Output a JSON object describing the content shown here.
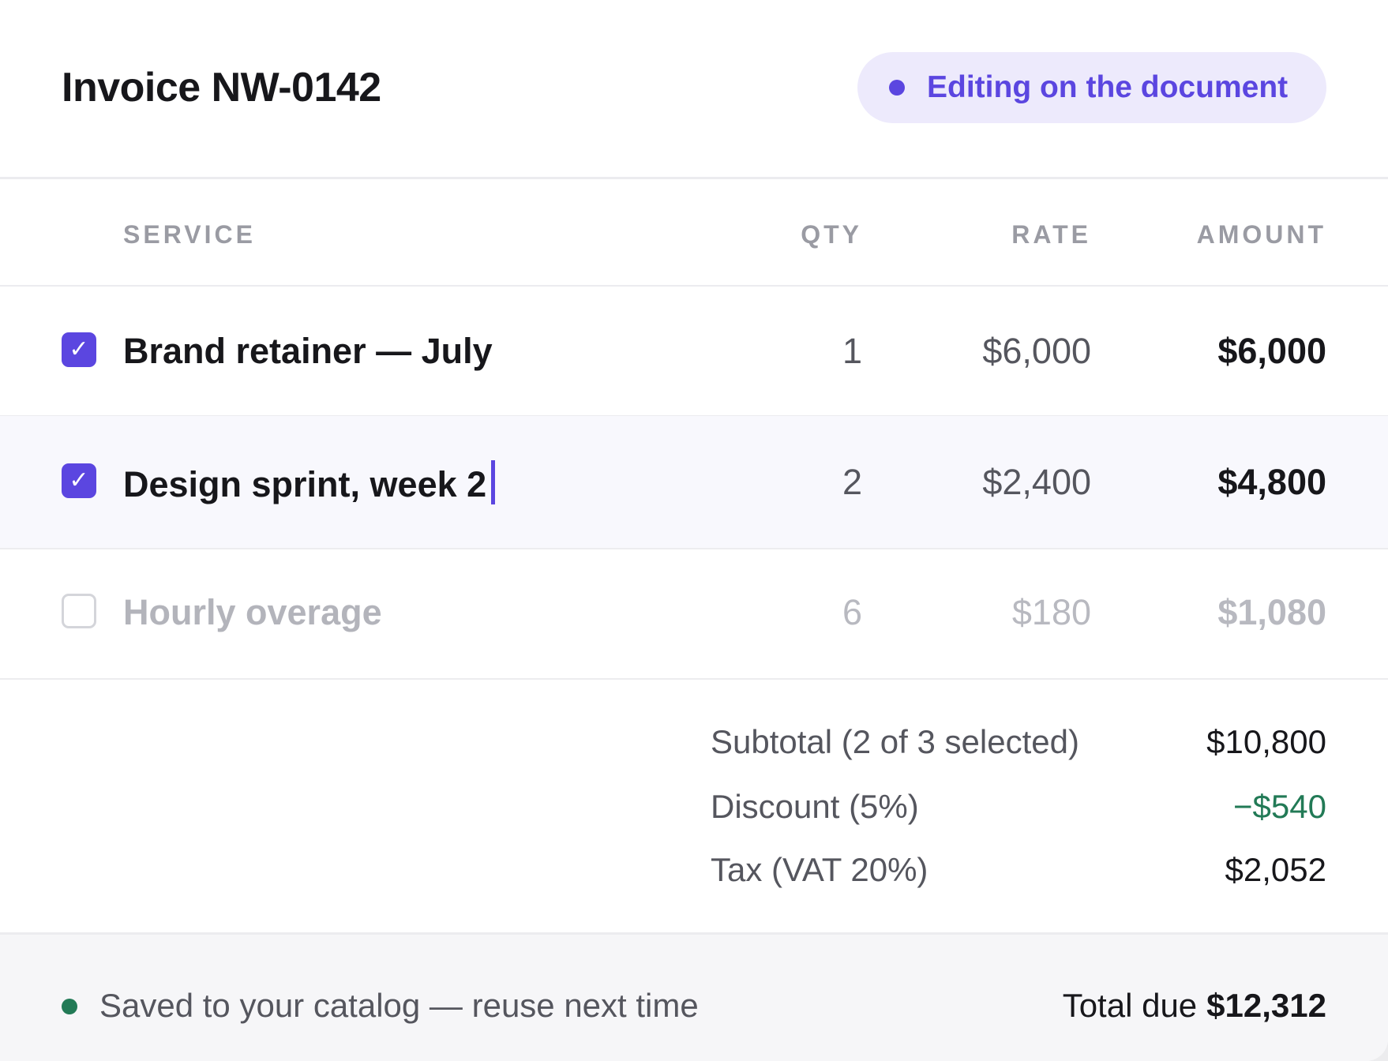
{
  "header": {
    "title": "Invoice NW-0142",
    "status_pill": "Editing on the document",
    "accent_color": "#5b46e0"
  },
  "columns": {
    "service": "SERVICE",
    "qty": "QTY",
    "rate": "RATE",
    "amount": "AMOUNT"
  },
  "rows": [
    {
      "checked": true,
      "service": "Brand retainer — July",
      "qty": "1",
      "rate": "$6,000",
      "amount": "$6,000"
    },
    {
      "checked": true,
      "service": "Design sprint, week 2",
      "qty": "2",
      "rate": "$2,400",
      "amount": "$4,800",
      "editing": true
    },
    {
      "checked": false,
      "service": "Hourly overage",
      "qty": "6",
      "rate": "$180",
      "amount": "$1,080"
    }
  ],
  "summary": {
    "subtotal_label": "Subtotal (2 of 3 selected)",
    "subtotal_value": "$10,800",
    "discount_label": "Discount (5%)",
    "discount_value": "−$540",
    "tax_label": "Tax (VAT 20%)",
    "tax_value": "$2,052"
  },
  "footer": {
    "saved_text": "Saved to your catalog — reuse next time",
    "total_label": "Total due",
    "total_value": "$12,312",
    "saved_color": "#227a56"
  },
  "icons": {
    "check": "✓"
  }
}
